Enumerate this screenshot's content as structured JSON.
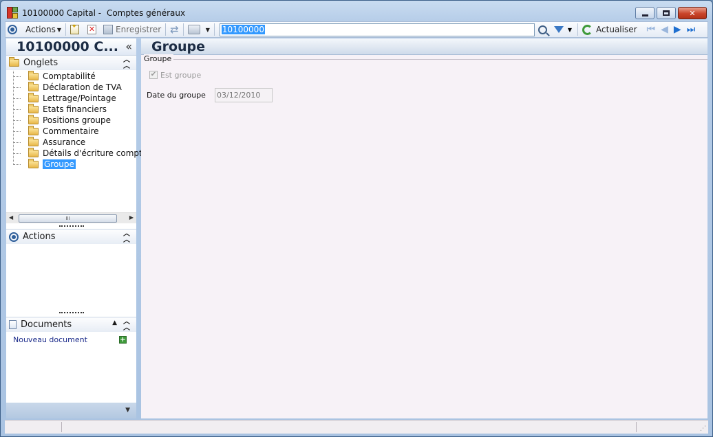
{
  "window": {
    "title_code": "10100000 Capital -",
    "title_module": "Comptes généraux"
  },
  "toolbar": {
    "actions_label": "Actions",
    "save_label": "Enregistrer",
    "search_value": "10100000",
    "refresh_label": "Actualiser"
  },
  "left": {
    "header": "10100000 C...",
    "collapse_glyph": "«",
    "tabs_section": "Onglets",
    "tree_items": [
      {
        "label": "Comptabilité"
      },
      {
        "label": "Déclaration de TVA"
      },
      {
        "label": "Lettrage/Pointage"
      },
      {
        "label": "Etats financiers"
      },
      {
        "label": "Positions groupe"
      },
      {
        "label": "Commentaire"
      },
      {
        "label": "Assurance"
      },
      {
        "label": "Détails d'écriture comptab"
      },
      {
        "label": "Groupe",
        "selected": true
      }
    ],
    "scroll_thumb": "III",
    "actions_section": "Actions",
    "documents_section": "Documents",
    "new_document": "Nouveau document"
  },
  "main": {
    "header": "Groupe",
    "group_title": "Groupe",
    "est_groupe_label": "Est groupe",
    "est_groupe_checked": true,
    "date_label": "Date du groupe",
    "date_value": "03/12/2010"
  },
  "colors": {
    "selection": "#3399ff",
    "header_text": "#1c2c44",
    "link": "#1a2a8a"
  }
}
